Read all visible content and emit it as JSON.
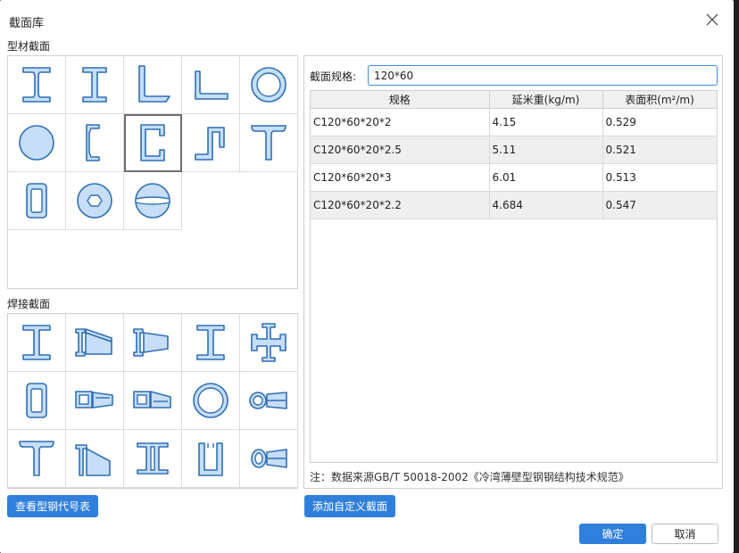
{
  "dialog": {
    "title": "截面库"
  },
  "profile_section": {
    "label": "型材截面",
    "items": [
      "i-beam-wide",
      "i-beam",
      "equal-angle",
      "unequal-angle",
      "round-tube",
      "round-bar",
      "lipped-channel",
      "c-channel",
      "z-section",
      "t-section",
      "rect-tube",
      "hex-nut",
      "split-sphere"
    ],
    "selected": "c-channel"
  },
  "welded_section": {
    "label": "焊接截面",
    "items": [
      "welded-i",
      "tapered-i",
      "tapered-i-2",
      "welded-i-narrow",
      "cross-section",
      "box-section",
      "tapered-box",
      "tapered-box-2",
      "welded-pipe",
      "tapered-pipe",
      "welded-t",
      "tapered-t",
      "double-channel",
      "u-channel",
      "tapered-ellipse"
    ]
  },
  "spec": {
    "label": "截面规格:",
    "value": "120*60"
  },
  "table": {
    "headers": [
      "规格",
      "延米重(kg/m)",
      "表面积(m²/m)"
    ],
    "rows": [
      [
        "C120*60*20*2",
        "4.15",
        "0.529"
      ],
      [
        "C120*60*20*2.5",
        "5.11",
        "0.521"
      ],
      [
        "C120*60*20*3",
        "6.01",
        "0.513"
      ],
      [
        "C120*60*20*2.2",
        "4.684",
        "0.547"
      ]
    ]
  },
  "note": "注：数据来源GB/T 50018-2002《冷湾薄壁型钢钢结构技术规范》",
  "buttons": {
    "view_codes": "查看型钢代号表",
    "add_custom": "添加自定义截面",
    "ok": "确定",
    "cancel": "取消"
  },
  "colors": {
    "accent": "#2f7fdb",
    "shape_fill": "#c6def7",
    "shape_stroke": "#2f6fb4"
  }
}
